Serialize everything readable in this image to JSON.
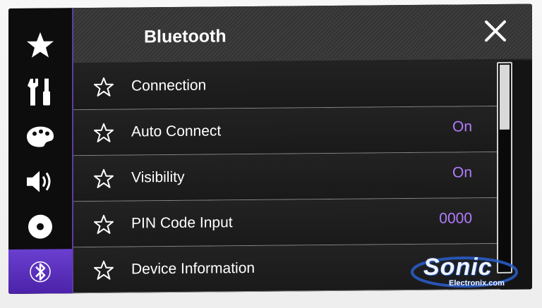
{
  "header": {
    "title": "Bluetooth"
  },
  "sidebar": {
    "items": [
      {
        "name": "favorites",
        "icon": "star-icon"
      },
      {
        "name": "settings",
        "icon": "tools-icon"
      },
      {
        "name": "theme",
        "icon": "palette-icon"
      },
      {
        "name": "audio",
        "icon": "speaker-icon"
      },
      {
        "name": "disc",
        "icon": "disc-icon"
      },
      {
        "name": "bluetooth",
        "icon": "bluetooth-icon",
        "active": true
      }
    ]
  },
  "menu": {
    "rows": [
      {
        "label": "Connection",
        "value": ""
      },
      {
        "label": "Auto Connect",
        "value": "On"
      },
      {
        "label": "Visibility",
        "value": "On"
      },
      {
        "label": "PIN Code Input",
        "value": "0000"
      },
      {
        "label": "Device Information",
        "value": ""
      }
    ]
  },
  "watermark": {
    "brand": "Sonic",
    "sub": "Electronix.com"
  },
  "colors": {
    "accent": "#6a3fd0",
    "value_text": "#b27cff"
  }
}
